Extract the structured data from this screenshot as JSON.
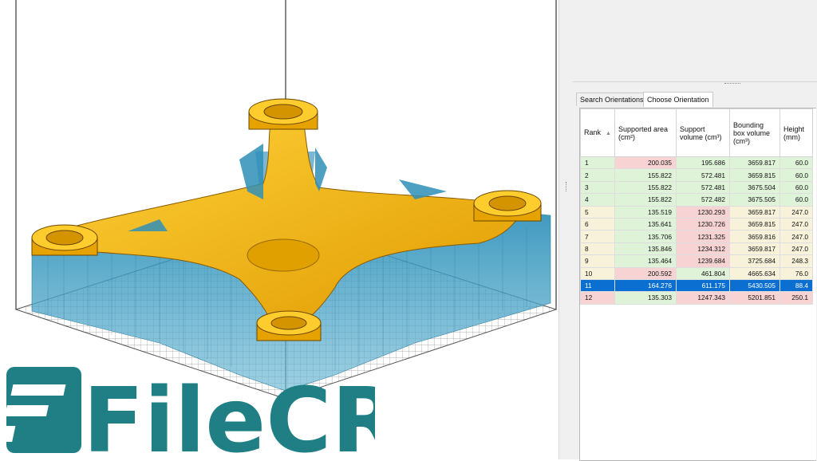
{
  "tabs": [
    {
      "label": "Search Orientations"
    },
    {
      "label": "Choose Orientation"
    }
  ],
  "table": {
    "columns": {
      "rank": "Rank",
      "supported_area": "Supported area (cm²)",
      "support_volume": "Support volume (cm³)",
      "bbox_volume": "Bounding box volume (cm³)",
      "height": "Height (mm)"
    },
    "rows": [
      {
        "rank": "1",
        "area": "200.035",
        "volume": "195.686",
        "bbox": "3659.817",
        "height": "60.0",
        "colors": [
          "green",
          "red",
          "green",
          "green",
          "green"
        ]
      },
      {
        "rank": "2",
        "area": "155.822",
        "volume": "572.481",
        "bbox": "3659.815",
        "height": "60.0",
        "colors": [
          "green",
          "green",
          "green",
          "green",
          "green"
        ]
      },
      {
        "rank": "3",
        "area": "155.822",
        "volume": "572.481",
        "bbox": "3675.504",
        "height": "60.0",
        "colors": [
          "green",
          "green",
          "green",
          "green",
          "green"
        ]
      },
      {
        "rank": "4",
        "area": "155.822",
        "volume": "572.482",
        "bbox": "3675.505",
        "height": "60.0",
        "colors": [
          "green",
          "green",
          "green",
          "green",
          "green"
        ]
      },
      {
        "rank": "5",
        "area": "135.519",
        "volume": "1230.293",
        "bbox": "3659.817",
        "height": "247.0",
        "colors": [
          "yellow",
          "green",
          "red",
          "yellow",
          "yellow"
        ]
      },
      {
        "rank": "6",
        "area": "135.641",
        "volume": "1230.726",
        "bbox": "3659.815",
        "height": "247.0",
        "colors": [
          "yellow",
          "green",
          "red",
          "yellow",
          "yellow"
        ]
      },
      {
        "rank": "7",
        "area": "135.706",
        "volume": "1231.325",
        "bbox": "3659.816",
        "height": "247.0",
        "colors": [
          "yellow",
          "green",
          "red",
          "yellow",
          "yellow"
        ]
      },
      {
        "rank": "8",
        "area": "135.846",
        "volume": "1234.312",
        "bbox": "3659.817",
        "height": "247.0",
        "colors": [
          "yellow",
          "green",
          "red",
          "yellow",
          "yellow"
        ]
      },
      {
        "rank": "9",
        "area": "135.464",
        "volume": "1239.684",
        "bbox": "3725.684",
        "height": "248.3",
        "colors": [
          "yellow",
          "green",
          "red",
          "yellow",
          "yellow"
        ]
      },
      {
        "rank": "10",
        "area": "200.592",
        "volume": "461.804",
        "bbox": "4665.634",
        "height": "76.0",
        "colors": [
          "yellow",
          "red",
          "green",
          "yellow",
          "yellow"
        ]
      },
      {
        "rank": "11",
        "area": "164.276",
        "volume": "611.175",
        "bbox": "5430.505",
        "height": "88.4",
        "selected": true,
        "colors": [
          "",
          "",
          "",
          "",
          ""
        ]
      },
      {
        "rank": "12",
        "area": "135.303",
        "volume": "1247.343",
        "bbox": "5201.851",
        "height": "250.1",
        "colors": [
          "red",
          "green",
          "red",
          "red",
          "red"
        ]
      }
    ]
  },
  "watermark": {
    "text": "FileCR"
  },
  "colors": {
    "part": "#f4b400",
    "support": "#2f8fb8",
    "selected": "#0a6fd0",
    "watermark": "#1f7f84"
  }
}
